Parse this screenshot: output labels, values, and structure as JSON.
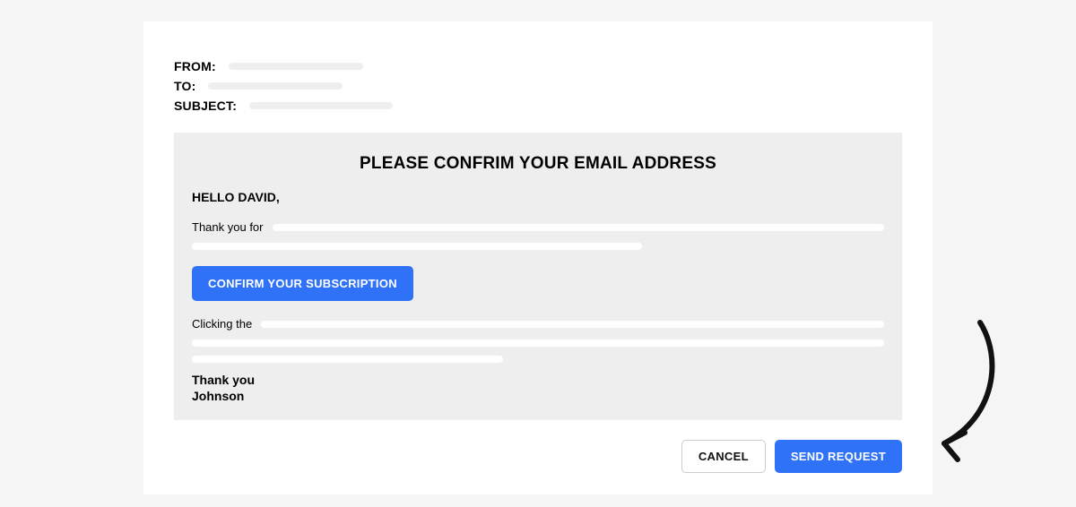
{
  "header": {
    "from_label": "FROM:",
    "to_label": "TO:",
    "subject_label": "SUBJECT:"
  },
  "body": {
    "title": "PLEASE CONFRIM YOUR EMAIL ADDRESS",
    "greeting": "HELLO DAVID,",
    "para1_lead": "Thank you for",
    "confirm_button": "CONFIRM YOUR SUBSCRIPTION",
    "para2_lead": "Clicking the",
    "signoff_line1": "Thank you",
    "signoff_line2": "Johnson"
  },
  "footer": {
    "cancel": "CANCEL",
    "send": "SEND REQUEST"
  },
  "colors": {
    "accent": "#2F72F7",
    "panel": "#eeeeee",
    "placeholder": "#eeeeee"
  }
}
